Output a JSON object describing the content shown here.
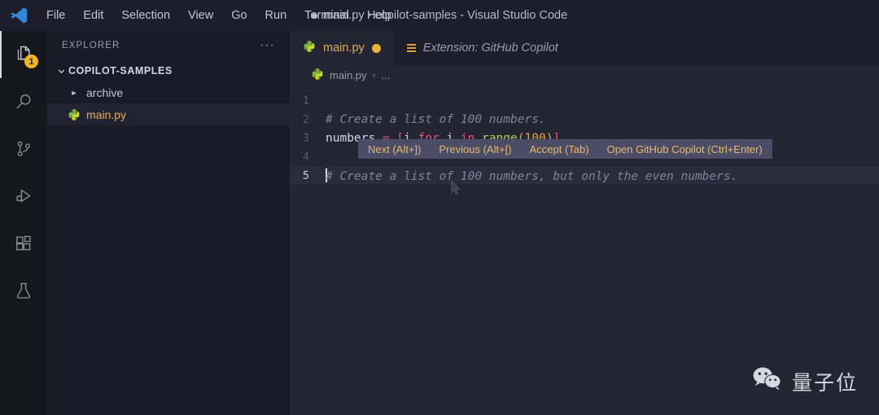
{
  "window": {
    "title": "main.py - copilot-samples - Visual Studio Code",
    "dirty": true,
    "logo": "vscode-logo"
  },
  "menubar": {
    "items": [
      {
        "label": "File"
      },
      {
        "label": "Edit"
      },
      {
        "label": "Selection"
      },
      {
        "label": "View"
      },
      {
        "label": "Go"
      },
      {
        "label": "Run"
      },
      {
        "label": "Terminal"
      },
      {
        "label": "Help"
      }
    ]
  },
  "activitybar": {
    "items": [
      {
        "name": "explorer",
        "icon": "files-icon",
        "active": true,
        "badge": "1"
      },
      {
        "name": "search",
        "icon": "search-icon",
        "active": false,
        "badge": ""
      },
      {
        "name": "source-control",
        "icon": "source-control-icon",
        "active": false,
        "badge": ""
      },
      {
        "name": "run-and-debug",
        "icon": "run-debug-icon",
        "active": false,
        "badge": ""
      },
      {
        "name": "extensions",
        "icon": "extensions-icon",
        "active": false,
        "badge": ""
      },
      {
        "name": "testing",
        "icon": "beaker-icon",
        "active": false,
        "badge": ""
      }
    ]
  },
  "sidebar": {
    "title": "EXPLORER",
    "more_actions": "···",
    "root_folder": "COPILOT-SAMPLES",
    "tree": [
      {
        "label": "archive",
        "type": "folder",
        "expanded": false,
        "selected": false
      },
      {
        "label": "main.py",
        "type": "python-file",
        "expanded": false,
        "selected": true
      }
    ]
  },
  "editor": {
    "tabs": [
      {
        "label": "main.py",
        "icon": "python-icon",
        "active": true,
        "dirty": true
      },
      {
        "label": "Extension: GitHub Copilot",
        "icon": "extension-icon",
        "active": false,
        "dirty": false
      }
    ],
    "breadcrumb": {
      "icon": "python-icon",
      "file": "main.py",
      "separator": "›",
      "tail": "..."
    },
    "lines": [
      {
        "number": "1",
        "kind": "empty",
        "text": ""
      },
      {
        "number": "2",
        "kind": "comment",
        "text": "# Create a list of 100 numbers."
      },
      {
        "number": "3",
        "kind": "code",
        "text": "numbers = [i for i in range(100)]"
      },
      {
        "number": "4",
        "kind": "empty",
        "text": ""
      },
      {
        "number": "5",
        "kind": "ghost",
        "text": "# Create a list of 100 numbers, but only the even numbers.",
        "active": true
      }
    ],
    "code_tokens_line3": {
      "var": "numbers",
      "eq": " = ",
      "open_bracket": "[",
      "i1": "i",
      "for": " for ",
      "i2": "i",
      "in": " in ",
      "fn": "range",
      "paren_open": "(",
      "num": "100",
      "paren_close": ")",
      "close_bracket": "]"
    }
  },
  "copilot_suggestion_toolbar": {
    "actions": [
      {
        "label": "Next (Alt+])"
      },
      {
        "label": "Previous (Alt+[)"
      },
      {
        "label": "Accept (Tab)"
      },
      {
        "label": "Open GitHub Copilot (Ctrl+Enter)"
      }
    ]
  },
  "watermark": {
    "icon": "wechat-icon",
    "text": "量子位"
  },
  "colors": {
    "titlebar_bg": "#1d1d2b",
    "activitybar_bg": "#16161f",
    "sidebar_bg": "#1b1b28",
    "editor_bg": "#232533",
    "accent_yellow": "#dfae5a",
    "badge_bg": "#f0b429",
    "copilot_toolbar_bg": "#4b4c66",
    "copilot_action_fg": "#e8b86a",
    "python_green": "#8bc34a",
    "keyword_pink": "#e0557b",
    "number_orange": "#e8a33d",
    "comment_grey": "#7f8496"
  }
}
